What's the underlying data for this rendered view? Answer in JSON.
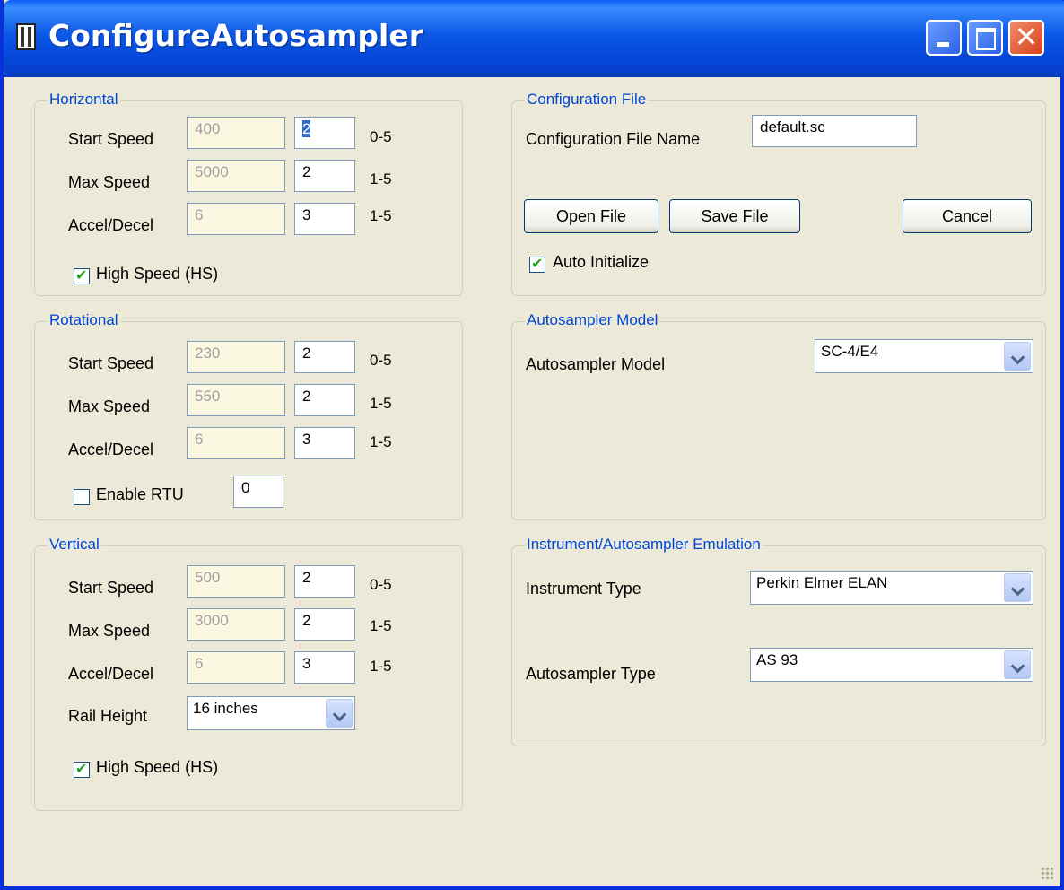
{
  "window": {
    "title": "ConfigureAutosampler",
    "accent": "#0046D5",
    "close_glyph": "✕"
  },
  "horizontal": {
    "legend": "Horizontal",
    "rows": [
      {
        "label": "Start Speed",
        "readonly": "400",
        "value": "2",
        "range": "0-5"
      },
      {
        "label": "Max Speed",
        "readonly": "5000",
        "value": "2",
        "range": "1-5"
      },
      {
        "label": "Accel/Decel",
        "readonly": "6",
        "value": "3",
        "range": "1-5"
      }
    ],
    "high_speed_label": "High Speed (HS)",
    "high_speed_checked": true
  },
  "rotational": {
    "legend": "Rotational",
    "rows": [
      {
        "label": "Start Speed",
        "readonly": "230",
        "value": "2",
        "range": "0-5"
      },
      {
        "label": "Max Speed",
        "readonly": "550",
        "value": "2",
        "range": "1-5"
      },
      {
        "label": "Accel/Decel",
        "readonly": "6",
        "value": "3",
        "range": "1-5"
      }
    ],
    "enable_rtu_label": "Enable RTU",
    "enable_rtu_checked": false,
    "rtu_value": "0"
  },
  "vertical": {
    "legend": "Vertical",
    "rows": [
      {
        "label": "Start Speed",
        "readonly": "500",
        "value": "2",
        "range": "0-5"
      },
      {
        "label": "Max Speed",
        "readonly": "3000",
        "value": "2",
        "range": "1-5"
      },
      {
        "label": "Accel/Decel",
        "readonly": "6",
        "value": "3",
        "range": "1-5"
      }
    ],
    "rail_height_label": "Rail Height",
    "rail_height_value": "16 inches",
    "high_speed_label": "High Speed (HS)",
    "high_speed_checked": true
  },
  "config_file": {
    "legend": "Configuration File",
    "name_label": "Configuration File Name",
    "name_value": "default.sc",
    "open_label": "Open File",
    "save_label": "Save File",
    "cancel_label": "Cancel",
    "auto_init_label": "Auto Initialize",
    "auto_init_checked": true
  },
  "model": {
    "legend": "Autosampler Model",
    "label": "Autosampler Model",
    "value": "SC-4/E4"
  },
  "emulation": {
    "legend": "Instrument/Autosampler Emulation",
    "instrument_label": "Instrument Type",
    "instrument_value": "Perkin Elmer ELAN",
    "autosampler_label": "Autosampler Type",
    "autosampler_value": "AS 93"
  }
}
